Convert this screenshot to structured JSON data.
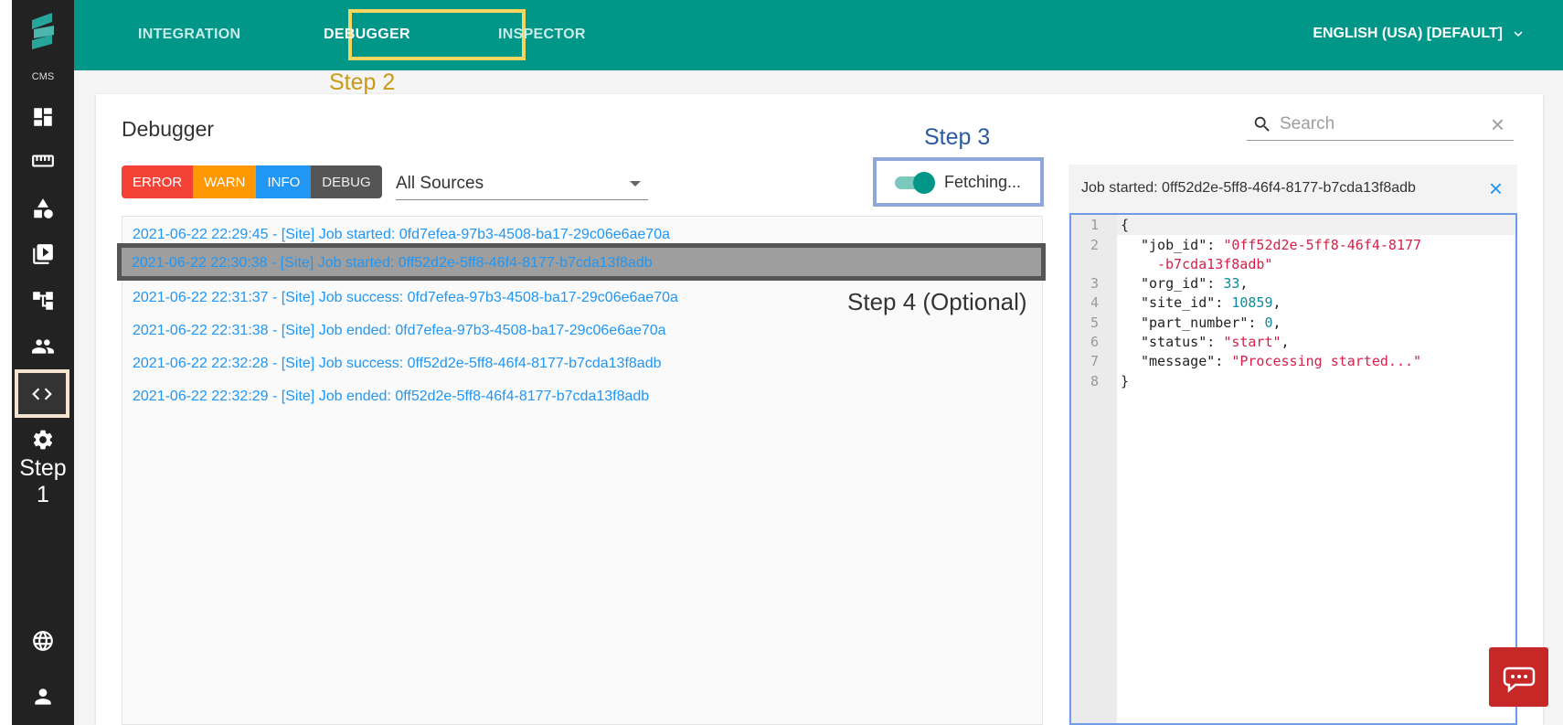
{
  "sidebar": {
    "cms_label": "CMS",
    "step_label": "Step 1"
  },
  "topbar": {
    "tabs": [
      {
        "label": "INTEGRATION"
      },
      {
        "label": "DEBUGGER"
      },
      {
        "label": "INSPECTOR"
      }
    ],
    "language": "ENGLISH (USA) [DEFAULT]",
    "step_label": "Step 2"
  },
  "debugger": {
    "title": "Debugger",
    "search_placeholder": "Search",
    "levels": [
      "ERROR",
      "WARN",
      "INFO",
      "DEBUG"
    ],
    "source": "All Sources",
    "fetch_label": "Fetching...",
    "step3_label": "Step 3",
    "step4_label": "Step 4 (Optional)",
    "logs": [
      "2021-06-22 22:29:45 - [Site] Job started: 0fd7efea-97b3-4508-ba17-29c06e6ae70a",
      "2021-06-22 22:30:38 - [Site] Job started: 0ff52d2e-5ff8-46f4-8177-b7cda13f8adb",
      "2021-06-22 22:31:37 - [Site] Job success: 0fd7efea-97b3-4508-ba17-29c06e6ae70a",
      "2021-06-22 22:31:38 - [Site] Job ended: 0fd7efea-97b3-4508-ba17-29c06e6ae70a",
      "2021-06-22 22:32:28 - [Site] Job success: 0ff52d2e-5ff8-46f4-8177-b7cda13f8adb",
      "2021-06-22 22:32:29 - [Site] Job ended: 0ff52d2e-5ff8-46f4-8177-b7cda13f8adb"
    ]
  },
  "detail": {
    "header": "Job started: 0ff52d2e-5ff8-46f4-8177-b7cda13f8adb",
    "line_numbers": [
      "1",
      "2",
      "3",
      "4",
      "5",
      "6",
      "7",
      "8"
    ],
    "json_lines": {
      "open": "{",
      "job_id_key": "\"job_id\"",
      "job_id_val_1": "\"0ff52d2e-5ff8-46f4-8177",
      "job_id_val_2": "-b7cda13f8adb\"",
      "org_id_key": "\"org_id\"",
      "org_id_val": "33",
      "site_id_key": "\"site_id\"",
      "site_id_val": "10859",
      "part_number_key": "\"part_number\"",
      "part_number_val": "0",
      "status_key": "\"status\"",
      "status_val": "\"start\"",
      "message_key": "\"message\"",
      "message_val": "\"Processing started...\"",
      "close": "}"
    }
  },
  "colors": {
    "primary": "#009688",
    "error": "#f44336",
    "warn": "#ff9800",
    "info": "#2196f3",
    "debug": "#555555"
  }
}
